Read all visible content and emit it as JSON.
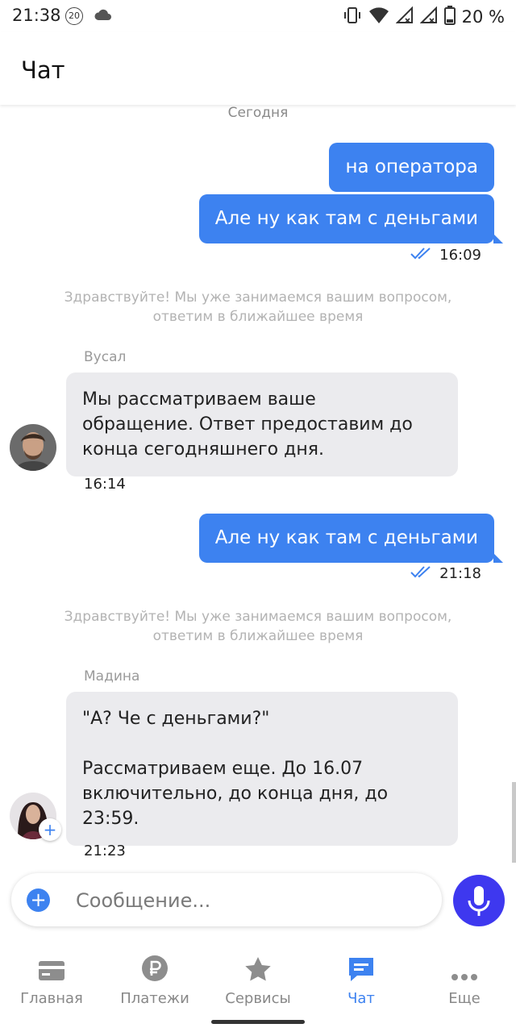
{
  "status_bar": {
    "time": "21:38",
    "badge": "20",
    "battery": "20 %"
  },
  "app_bar": {
    "title": "Чат"
  },
  "chat": {
    "date_separator": "Сегодня",
    "messages": [
      {
        "text": "на оператора"
      },
      {
        "text": "Але ну как там с деньгами",
        "time": "16:09"
      },
      {
        "system": "Здравствуйте! Мы уже занимаемся вашим вопросом,\nответим в ближайшее время"
      },
      {
        "sender": "Вусал",
        "text": "Мы рассматриваем ваше\nобращение. Ответ предоставим до\nконца сегодняшнего дня.",
        "time": "16:14"
      },
      {
        "text": "Але ну как там с деньгами",
        "time": "21:18"
      },
      {
        "system": "Здравствуйте! Мы уже занимаемся вашим вопросом,\nответим в ближайшее время"
      },
      {
        "sender": "Мадина",
        "text": "\"А? Че с деньгами?\"\n\nРассматриваем еще. До 16.07\nвключительно, до конца дня, до\n23:59.",
        "time": "21:23"
      }
    ]
  },
  "composer": {
    "placeholder": "Сообщение..."
  },
  "tabs": [
    {
      "label": "Главная",
      "icon": "card-icon"
    },
    {
      "label": "Платежи",
      "icon": "ruble-icon"
    },
    {
      "label": "Сервисы",
      "icon": "star-icon"
    },
    {
      "label": "Чат",
      "icon": "chat-icon",
      "active": true
    },
    {
      "label": "Еще",
      "icon": "more-icon"
    }
  ],
  "colors": {
    "accent": "#3d82f0",
    "mic": "#3e38ef",
    "incoming_bubble": "#ebebee"
  }
}
